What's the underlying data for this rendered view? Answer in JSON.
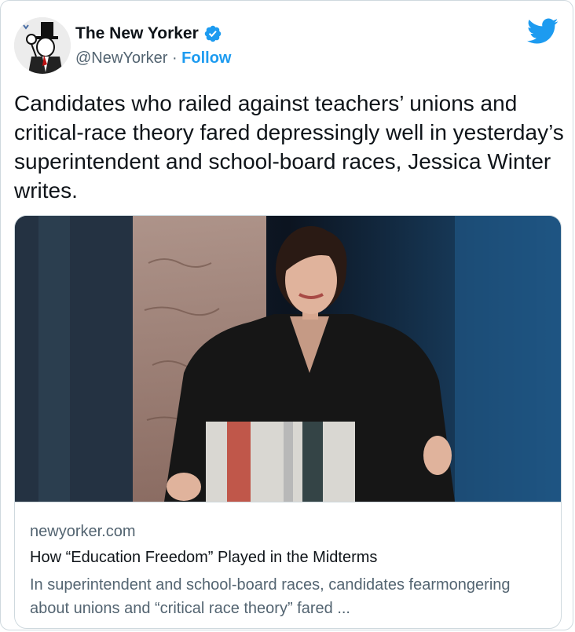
{
  "account": {
    "display_name": "The New Yorker",
    "handle": "@NewYorker",
    "separator": " · ",
    "follow_label": "Follow",
    "avatar_icon": "new-yorker-eustace-tilley-avatar",
    "verified_icon": "verified-badge-icon"
  },
  "tweet": {
    "text": "Candidates who railed against teachers’ unions and critical-race theory fared depressingly well in yesterday’s superintendent and school-board races, Jessica Winter writes."
  },
  "card": {
    "domain": "newyorker.com",
    "title": "How “Education Freedom” Played in the Midterms",
    "description": "In superintendent and school-board races, candidates fearmongering about unions and “critical race theory” fared ..."
  },
  "colors": {
    "accent": "#1d9bf0",
    "text_primary": "#0f1419",
    "text_secondary": "#536471",
    "border": "#cfd9de"
  }
}
